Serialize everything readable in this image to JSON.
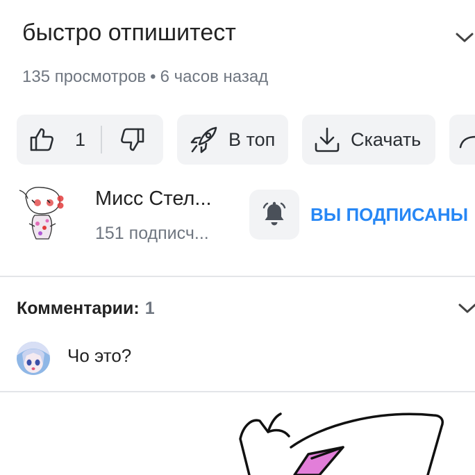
{
  "video": {
    "title": "быстро отпишитест",
    "views": "135 просмотров",
    "dot": "•",
    "time": "6 часов назад"
  },
  "actions": {
    "like_count": "1",
    "top_label": "В топ",
    "download_label": "Скачать"
  },
  "channel": {
    "name": "Мисс Стел...",
    "subscribers": "151 подписч...",
    "subscribed_label": "ВЫ ПОДПИСАНЫ"
  },
  "comments": {
    "heading": "Комментарии:",
    "count": "1",
    "first_comment": "Чо это?"
  },
  "colors": {
    "accent": "#2787f5",
    "icon": "#2a2e33",
    "bell": "#4a5059"
  },
  "icons": [
    "chevron-down-icon",
    "thumbs-up-icon",
    "thumbs-down-icon",
    "rocket-icon",
    "download-icon",
    "share-icon",
    "bell-icon"
  ]
}
